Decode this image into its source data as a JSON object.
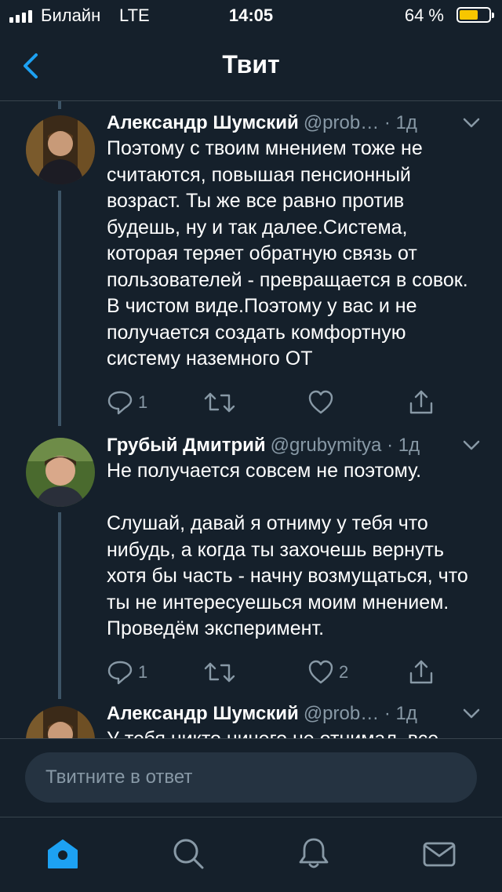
{
  "status_bar": {
    "carrier": "Билайн",
    "network": "LTE",
    "time": "14:05",
    "battery_percent": "64 %",
    "battery_level": 0.64
  },
  "header": {
    "title": "Твит",
    "back_icon": "chevron-left-icon"
  },
  "tweets": [
    {
      "name": "Александр Шумский",
      "handle": "@prob…",
      "time": "· 1д",
      "text": "Поэтому с твоим мнением тоже не считаются, повышая пенсионный возраст. Ты же все равно против будешь, ну и так далее.Система, которая теряет обратную связь от пользователей - превращается в совок. В чистом виде.Поэтому у вас и не получается создать комфортную систему наземного ОТ",
      "replies": "1",
      "retweets": "",
      "likes": ""
    },
    {
      "name": "Грубый Дмитрий",
      "handle": "@grubymitya",
      "time": "· 1д",
      "text": "Не получается совсем не поэтому.\n\nСлушай, давай я отниму у тебя что нибудь, а когда ты захочешь вернуть хотя бы часть - начну возмущаться, что ты не интересуешься моим мнением. Проведём эксперимент.",
      "replies": "1",
      "retweets": "",
      "likes": "2"
    },
    {
      "name": "Александр Шумский",
      "handle": "@prob…",
      "time": "· 1д",
      "text": "У тебя никто ничего не отнимал, все"
    }
  ],
  "reply": {
    "placeholder": "Твитните в ответ"
  },
  "tab_bar": {
    "items": [
      "home-icon",
      "search-icon",
      "notifications-icon",
      "messages-icon"
    ],
    "active": "home-icon"
  },
  "colors": {
    "background": "#15202b",
    "accent": "#1da1f2",
    "secondary_text": "#8899a6",
    "divider": "#38444d",
    "battery": "#f7c600"
  }
}
